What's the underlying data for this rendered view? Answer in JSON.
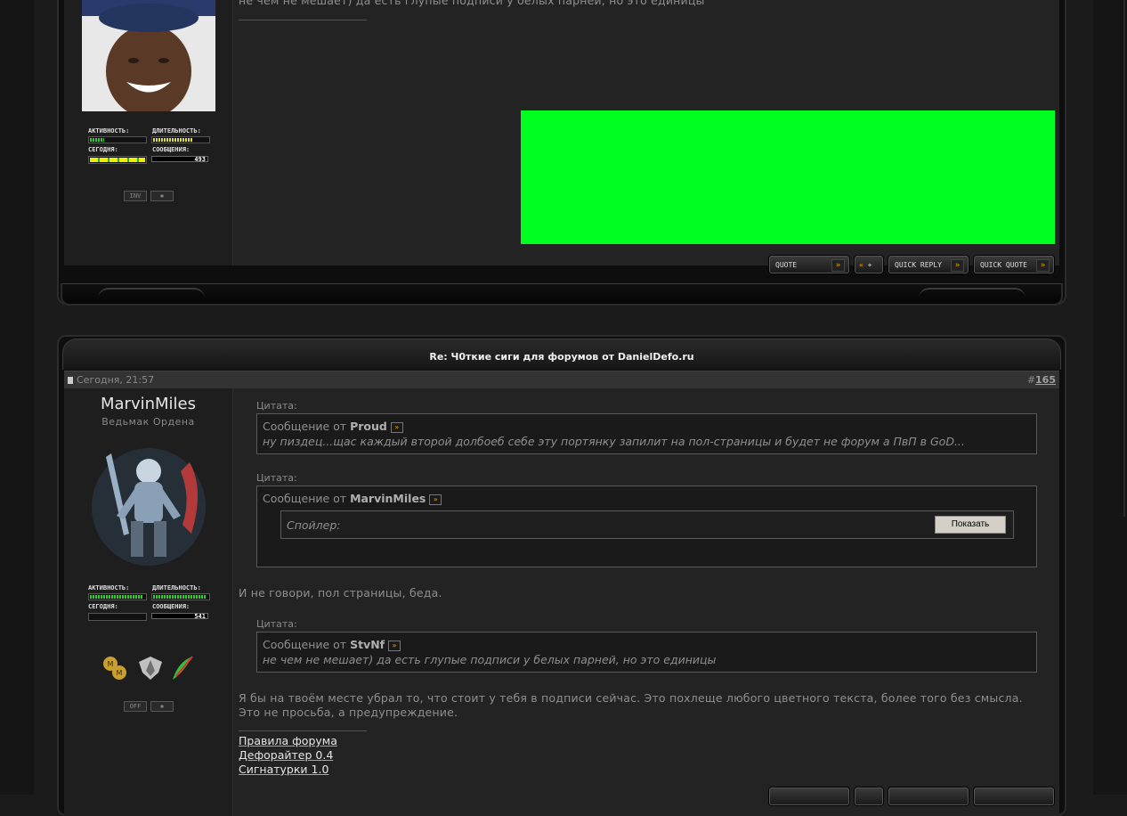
{
  "post1": {
    "text_top": "не чем не мешает) да есть глупые подписи у белых парней, но это единицы",
    "stats": {
      "activity_label": "АКТИВНОСТЬ:",
      "duration_label": "ДЛИТЕЛЬНОСТЬ:",
      "today_label": "СЕГОДНЯ:",
      "messages_label": "СООБЩЕНИЯ:",
      "messages_count": "493",
      "activity_level": 0.25,
      "duration_level": 0.72,
      "today_level": 1.0
    },
    "inv_label": "INV",
    "star_label": "✱",
    "buttons": {
      "quote": "QUOTE",
      "multi": "+",
      "quick_reply": "QUICK REPLY",
      "quick_quote": "QUICK QUOTE"
    }
  },
  "post2": {
    "title": "Re: Ч0ткие сиги для форумов от DanielDefo.ru",
    "date": "Сегодня, 21:57",
    "post_number_prefix": "#",
    "post_number": "165",
    "username": "MarvinMiles",
    "user_title": "Ведьмак Ордена",
    "stats": {
      "activity_label": "АКТИВНОСТЬ:",
      "duration_label": "ДЛИТЕЛЬНОСТЬ:",
      "today_label": "СЕГОДНЯ:",
      "messages_label": "СООБЩЕНИЯ:",
      "messages_count": "541",
      "activity_level": 0.95,
      "duration_level": 0.95,
      "today_level": 0.0
    },
    "off_label": "OFF",
    "star_label": "✱",
    "quote1": {
      "label": "Цитата:",
      "from_prefix": "Сообщение от ",
      "author": "Proud",
      "text": "ну пиздец...щас каждый второй долбоеб себе эту портянку запилит на пол-страницы и будет не форум а ПвП в GoD..."
    },
    "quote2": {
      "label": "Цитата:",
      "from_prefix": "Сообщение от ",
      "author": "MarvinMiles",
      "spoiler_label": "Спойлер:",
      "spoiler_button": "Показать"
    },
    "line1": "И не говори, пол страницы, беда.",
    "quote3": {
      "label": "Цитата:",
      "from_prefix": "Сообщение от ",
      "author": "StvNf",
      "text": "не чем не мешает) да есть глупые подписи у белых парней, но это единицы"
    },
    "para1": "Я бы на твоём месте убрал то, что стоит у тебя в подписи сейчас. Это похлеще любого цветного текста, более того без смысла.",
    "para2": "Это не просьба, а предупреждение.",
    "signature_links": [
      "Правила форума",
      "Дефорайтер 0.4",
      "Сигнатурки 1.0"
    ]
  },
  "colors": {
    "banner_green": "#00ff21",
    "accent_orange": "#e0a020"
  }
}
